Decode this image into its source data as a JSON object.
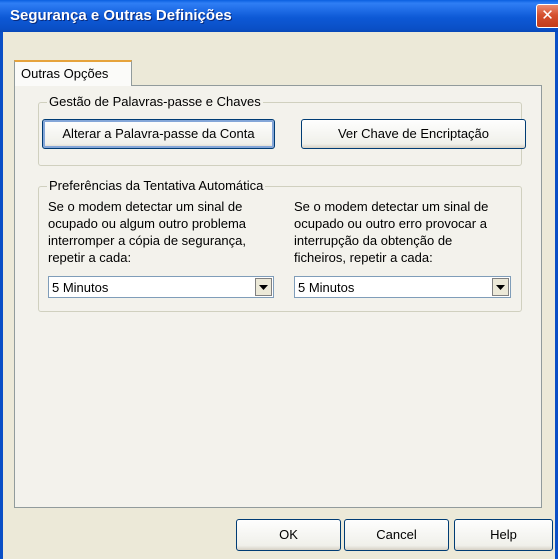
{
  "window": {
    "title": "Segurança e Outras Definições",
    "close_glyph": "✕"
  },
  "tabs": [
    {
      "label": "Outras Opções"
    }
  ],
  "passwords_group": {
    "title": "Gestão de Palavras-passe e Chaves",
    "change_password_label": "Alterar a Palavra-passe da Conta",
    "view_key_label": "Ver Chave de Encriptação"
  },
  "retry_group": {
    "title": "Preferências da Tentativa Automática",
    "backup_lines": [
      "Se o modem detectar um sinal de",
      "ocupado ou algum outro problema",
      "interromper a cópia de segurança,",
      "repetir a cada:"
    ],
    "retrieval_lines": [
      "Se o modem detectar um sinal de",
      "ocupado ou outro erro provocar a",
      "interrupção da obtenção de",
      "ficheiros, repetir a cada:"
    ],
    "backup_interval": "5 Minutos",
    "retrieval_interval": "5 Minutos"
  },
  "footer": {
    "ok_label": "OK",
    "cancel_label": "Cancel",
    "help_label": "Help"
  }
}
